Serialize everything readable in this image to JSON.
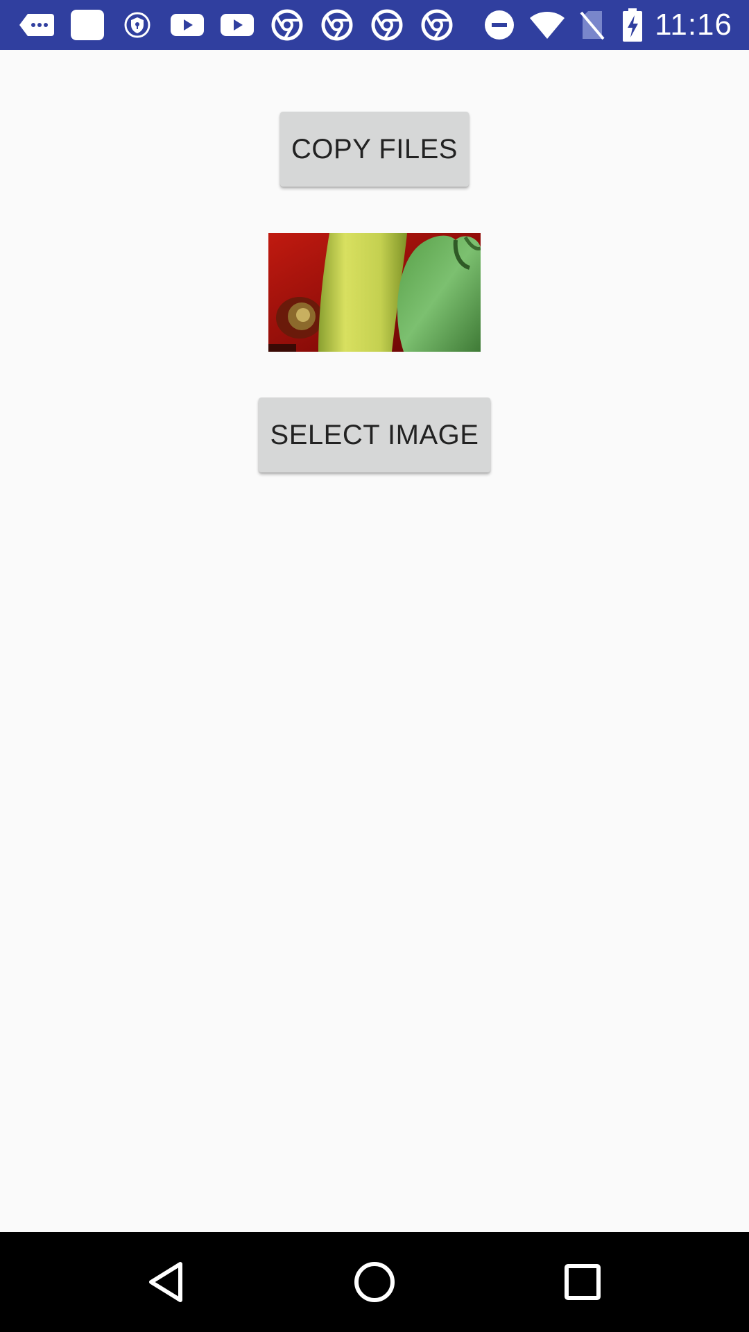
{
  "status_bar": {
    "time": "11:16",
    "background": "#303f9f",
    "icons": [
      "messages-icon",
      "notification-square-icon",
      "vpn-shield-icon",
      "youtube-icon",
      "youtube-icon",
      "chrome-icon",
      "chrome-icon",
      "chrome-icon",
      "chrome-icon",
      "do-not-disturb-icon",
      "wifi-icon",
      "no-sim-icon",
      "battery-charging-icon"
    ]
  },
  "main": {
    "copy_button_label": "COPY FILES",
    "select_button_label": "SELECT IMAGE",
    "button_color": "#d6d7d7",
    "preview_image": "peppers-image"
  },
  "nav_bar": {
    "icons": [
      "back-icon",
      "home-icon",
      "recents-icon"
    ]
  }
}
